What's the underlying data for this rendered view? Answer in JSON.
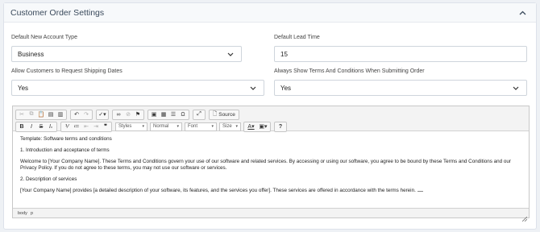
{
  "panel": {
    "title": "Customer Order Settings"
  },
  "fields": {
    "account_type": {
      "label": "Default New Account Type",
      "value": "Business"
    },
    "lead_time": {
      "label": "Default Lead Time",
      "value": "15"
    },
    "shipping_dates": {
      "label": "Allow Customers to Request Shipping Dates",
      "value": "Yes"
    },
    "terms_conditions": {
      "label": "Always Show Terms And Conditions When Submitting Order",
      "value": "Yes"
    }
  },
  "toolbar": {
    "source_label": "Source",
    "styles": "Styles",
    "format": "Normal",
    "font": "Font",
    "size": "Size"
  },
  "editor": {
    "paragraphs": [
      "Template: Software terms and conditions",
      "1. Introduction and acceptance of terms",
      "Welcome to [Your Company Name]. These Terms and Conditions govern your use of our software and related services. By accessing or using our software, you agree to be bound by these Terms and Conditions and our Privacy Policy. If you do not agree to these terms, you may not use our software or services.",
      "2. Description of services",
      "[Your Company Name] provides [a detailed description of your software, its features, and the services you offer]. These services are offered in accordance with the terms herein."
    ],
    "path": [
      "body",
      "p"
    ]
  }
}
